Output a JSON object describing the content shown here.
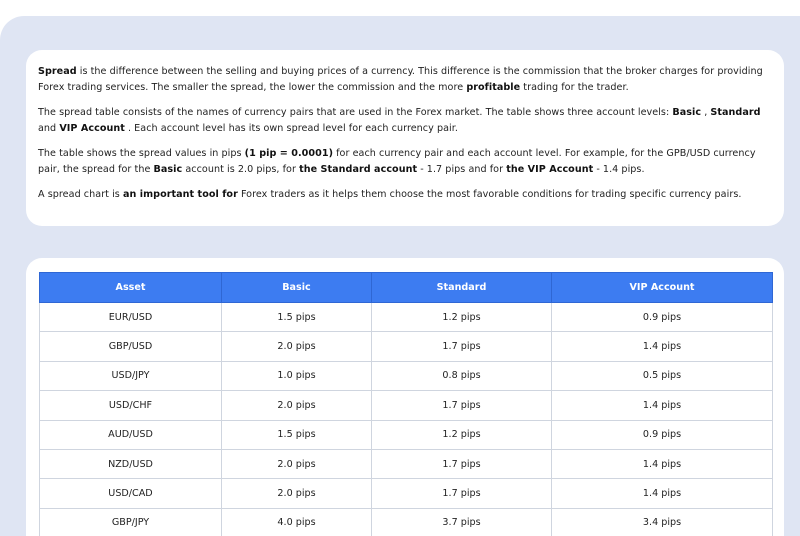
{
  "info": {
    "p1": {
      "b1": "Spread",
      "t1": " is the difference between the selling and buying prices of a currency. This difference is the commission that the broker charges for providing Forex trading services. The smaller the spread, the lower the commission and the more ",
      "b2": "profitable",
      "t2": " trading for the trader."
    },
    "p2": {
      "t1": "The spread table consists of the names of currency pairs that are used in the Forex market. The table shows three account levels: ",
      "b1": "Basic",
      "t2": " , ",
      "b2": "Standard",
      "t3": " and ",
      "b3": "VIP Account",
      "t4": " . Each account level has its own spread level for each currency pair."
    },
    "p3": {
      "t1": "The table shows the spread values in pips ",
      "b1": "(1 pip = 0.0001)",
      "t2": " for each currency pair and each account level. For example, for the GPB/USD currency pair, the spread for the ",
      "b2": "Basic",
      "t3": " account is 2.0 pips, for ",
      "b3": "the Standard account",
      "t4": " - 1.7 pips and for ",
      "b4": "the VIP Account",
      "t5": " - 1.4 pips."
    },
    "p4": {
      "t1": "A spread chart is ",
      "b1": "an important tool for",
      "t2": " Forex traders as it helps them choose the most favorable conditions for trading specific currency pairs."
    }
  },
  "table": {
    "headers": [
      "Asset",
      "Basic",
      "Standard",
      "VIP Account"
    ],
    "rows": [
      [
        "EUR/USD",
        "1.5 pips",
        "1.2 pips",
        "0.9 pips"
      ],
      [
        "GBP/USD",
        "2.0 pips",
        "1.7 pips",
        "1.4 pips"
      ],
      [
        "USD/JPY",
        "1.0 pips",
        "0.8 pips",
        "0.5 pips"
      ],
      [
        "USD/CHF",
        "2.0 pips",
        "1.7 pips",
        "1.4 pips"
      ],
      [
        "AUD/USD",
        "1.5 pips",
        "1.2 pips",
        "0.9 pips"
      ],
      [
        "NZD/USD",
        "2.0 pips",
        "1.7 pips",
        "1.4 pips"
      ],
      [
        "USD/CAD",
        "2.0 pips",
        "1.7 pips",
        "1.4 pips"
      ],
      [
        "GBP/JPY",
        "4.0 pips",
        "3.7 pips",
        "3.4 pips"
      ]
    ]
  }
}
